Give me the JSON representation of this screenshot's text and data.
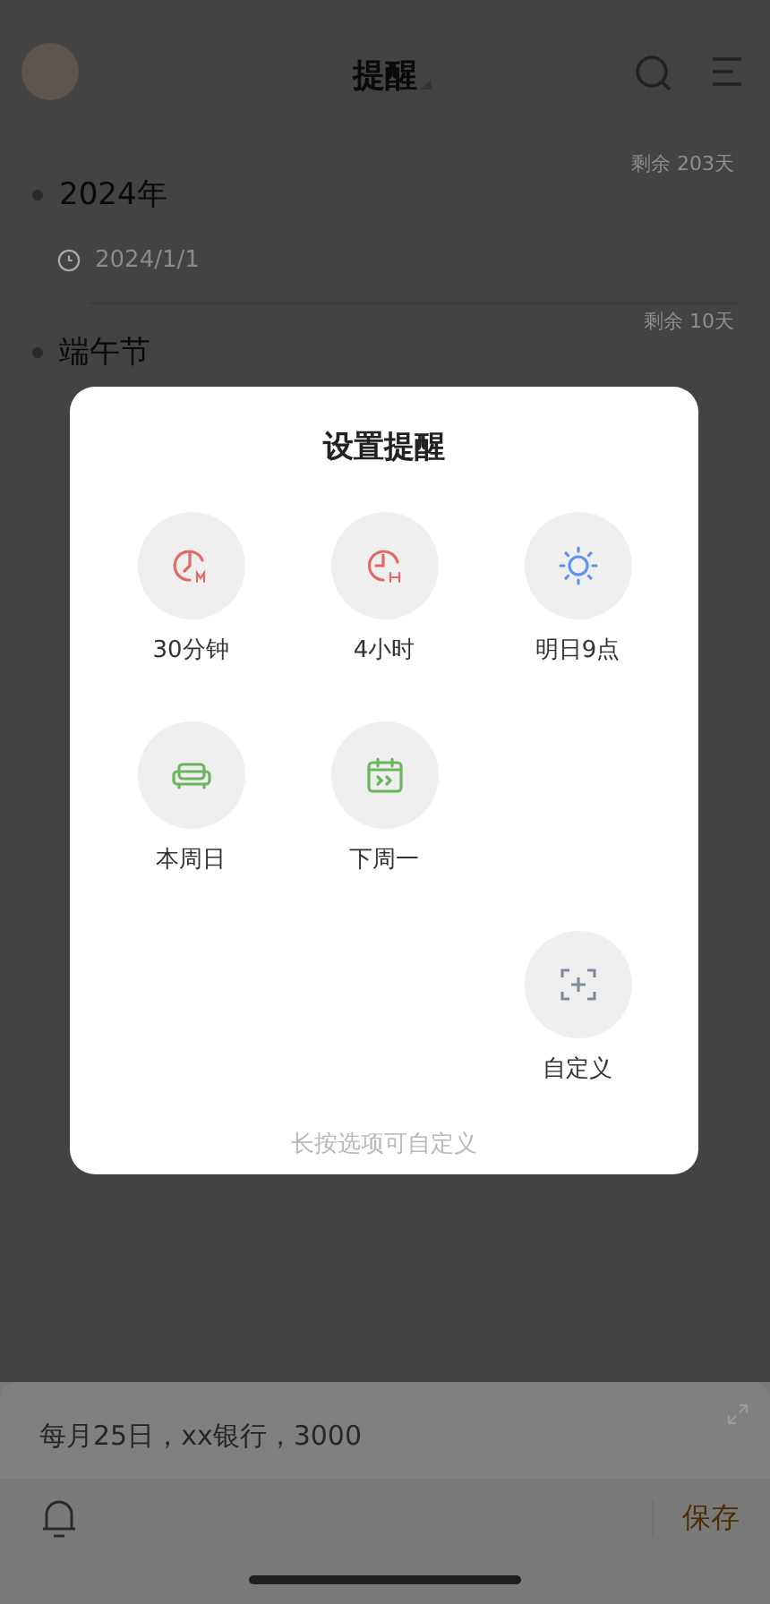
{
  "header": {
    "title": "提醒"
  },
  "reminders": [
    {
      "remaining": "剩余 203天",
      "title": "2024年",
      "date": "2024/1/1"
    },
    {
      "remaining": "剩余 10天",
      "title": "端午节"
    }
  ],
  "dialog": {
    "title": "设置提醒",
    "options": [
      {
        "kind": "minutes",
        "label": "30分钟"
      },
      {
        "kind": "hours",
        "label": "4小时"
      },
      {
        "kind": "sun",
        "label": "明日9点"
      },
      {
        "kind": "sofa",
        "label": "本周日"
      },
      {
        "kind": "calendar",
        "label": "下周一"
      }
    ],
    "custom_option": {
      "label": "自定义"
    },
    "hint": "长按选项可自定义"
  },
  "composer": {
    "value": "每月25日，xx银行，3000",
    "save": "保存"
  }
}
